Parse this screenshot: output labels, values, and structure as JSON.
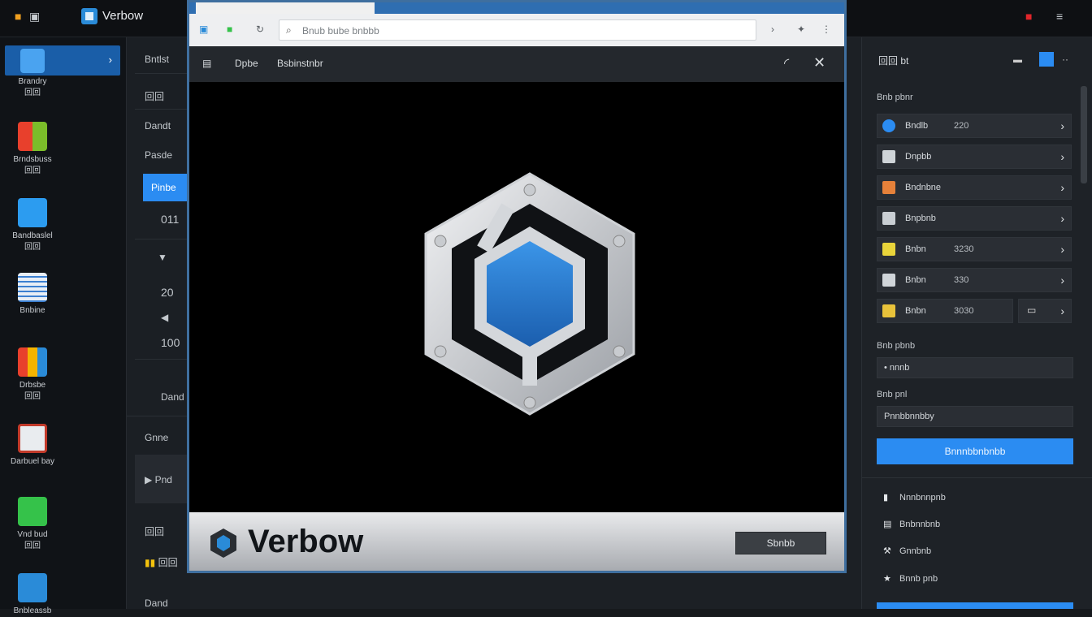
{
  "topbar": {
    "app_title": "Verbow",
    "icons": [
      "grid-icon",
      "window-icon",
      "menu-icon"
    ]
  },
  "dock": {
    "items": [
      {
        "label": "Brandry",
        "sub": "回回",
        "icon": "plugin-icon"
      },
      {
        "label": "Brndsbuss",
        "sub": "回回",
        "icon": "windows-icon"
      },
      {
        "label": "Bandbaslel",
        "sub": "回回",
        "icon": "folder-icon"
      },
      {
        "label": "Bnbine",
        "sub": "",
        "icon": "table-icon"
      },
      {
        "label": "Drbsbe",
        "sub": "回回",
        "icon": "tiles-icon"
      },
      {
        "label": "Darbuel bay",
        "sub": "",
        "icon": "screen-icon"
      },
      {
        "label": "Vnd bud",
        "sub": "回回",
        "icon": "phone-icon"
      },
      {
        "label": "Bnbleassb",
        "sub": "",
        "icon": "pencil-icon"
      }
    ]
  },
  "midpanel": {
    "rows": [
      "Bntlst",
      "回回",
      "Dandt",
      "Pasde",
      "Pinbe",
      "011",
      "",
      "20",
      "",
      "100",
      "Dand",
      "Gnne",
      "Pnd",
      "回回",
      "回回",
      "Dand"
    ]
  },
  "dialog": {
    "address": "Bnub bube bnbbb",
    "header_labels": [
      "Dpbe",
      "Bsbinstnbr"
    ],
    "brand": "Verbow",
    "footer_button": "Sbnbb"
  },
  "rpanel": {
    "header": "回回 bt",
    "section1": "Bnb pbnr",
    "items": [
      {
        "label": "Bndlb",
        "value": "220",
        "icon_color": "#2b8cf2",
        "icon": "globe-icon"
      },
      {
        "label": "Dnpbb",
        "value": "",
        "icon_color": "#cfd4d8",
        "icon": "grid-icon"
      },
      {
        "label": "Bndnbne",
        "value": "",
        "icon_color": "#e6813a",
        "icon": "image-icon"
      },
      {
        "label": "Bnpbnb",
        "value": "",
        "icon_color": "#c9ced3",
        "icon": "cursor-icon"
      },
      {
        "label": "Bnbn",
        "value": "3230",
        "icon_color": "#e9d43a",
        "icon": "note-icon"
      },
      {
        "label": "Bnbn",
        "value": "330",
        "icon_color": "#d0d5d9",
        "icon": "frame-icon"
      },
      {
        "label": "Bnbn",
        "value": "3030",
        "icon_color": "#e8c23a",
        "icon": "bar-icon"
      }
    ],
    "section2": "Bnb pbnb",
    "input1": "• nnnb",
    "section3": "Bnb pnl",
    "input2": "Pnnbbnnbby",
    "primary_button": "Bnnnbbnbnbb",
    "links": [
      {
        "label": "Nnnbnnpnb",
        "icon": "briefcase-icon"
      },
      {
        "label": "Bnbnnbnb",
        "icon": "printer-icon"
      },
      {
        "label": "Gnnbnb",
        "icon": "wrench-icon"
      },
      {
        "label": "Bnnb pnb",
        "icon": "star-icon"
      }
    ]
  }
}
